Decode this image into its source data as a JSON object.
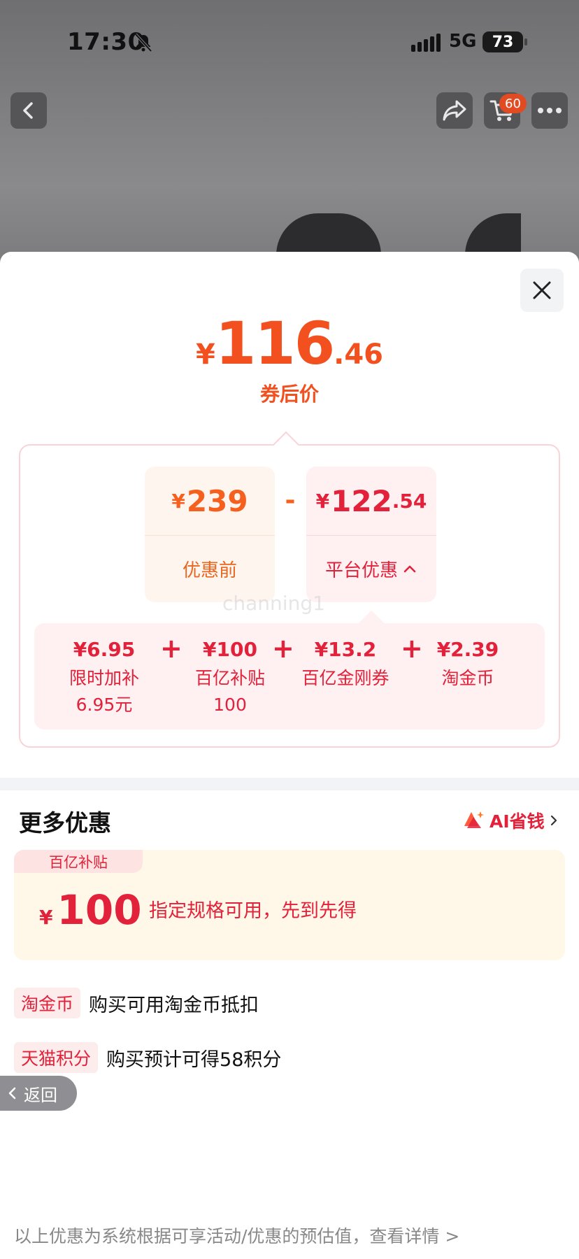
{
  "status_bar": {
    "time": "17:30",
    "network": "5G",
    "battery": "73"
  },
  "top_nav": {
    "cart_count": "60"
  },
  "summary": {
    "price_currency": "¥",
    "price_integer": "116",
    "price_decimal": ".46",
    "price_label": "券后价"
  },
  "breakdown": {
    "before": {
      "currency": "¥",
      "integer": "239",
      "decimal": "",
      "label": "优惠前"
    },
    "operator": "-",
    "platform": {
      "currency": "¥",
      "integer": "122",
      "decimal": ".54",
      "label": "平台优惠"
    },
    "watermark": "channing1",
    "items": [
      {
        "value": "¥6.95",
        "name_line1": "限时加补",
        "name_line2": "6.95元"
      },
      {
        "value": "¥100",
        "name_line1": "百亿补贴",
        "name_line2": "100"
      },
      {
        "value": "¥13.2",
        "name_line1": "百亿金刚券",
        "name_line2": ""
      },
      {
        "value": "¥2.39",
        "name_line1": "淘金币",
        "name_line2": ""
      }
    ],
    "plus": "+"
  },
  "more": {
    "title": "更多优惠",
    "ai_label": "AI省钱",
    "coupon": {
      "tag": "百亿补贴",
      "currency": "¥",
      "amount": "100",
      "desc": "指定规格可用，先到先得"
    },
    "lines": [
      {
        "tag": "淘金币",
        "text": "购买可用淘金币抵扣"
      },
      {
        "tag": "天猫积分",
        "text": "购买预计可得58积分"
      }
    ]
  },
  "float_back": {
    "label": "返回"
  },
  "footer": {
    "note": "以上优惠为系统根据可享活动/优惠的预估值，查看详情 >"
  },
  "colors": {
    "primary_orange": "#f2501f",
    "primary_red": "#e2213b",
    "panel_pink": "#fff1f2",
    "coupon_bg": "#fff8e9"
  }
}
